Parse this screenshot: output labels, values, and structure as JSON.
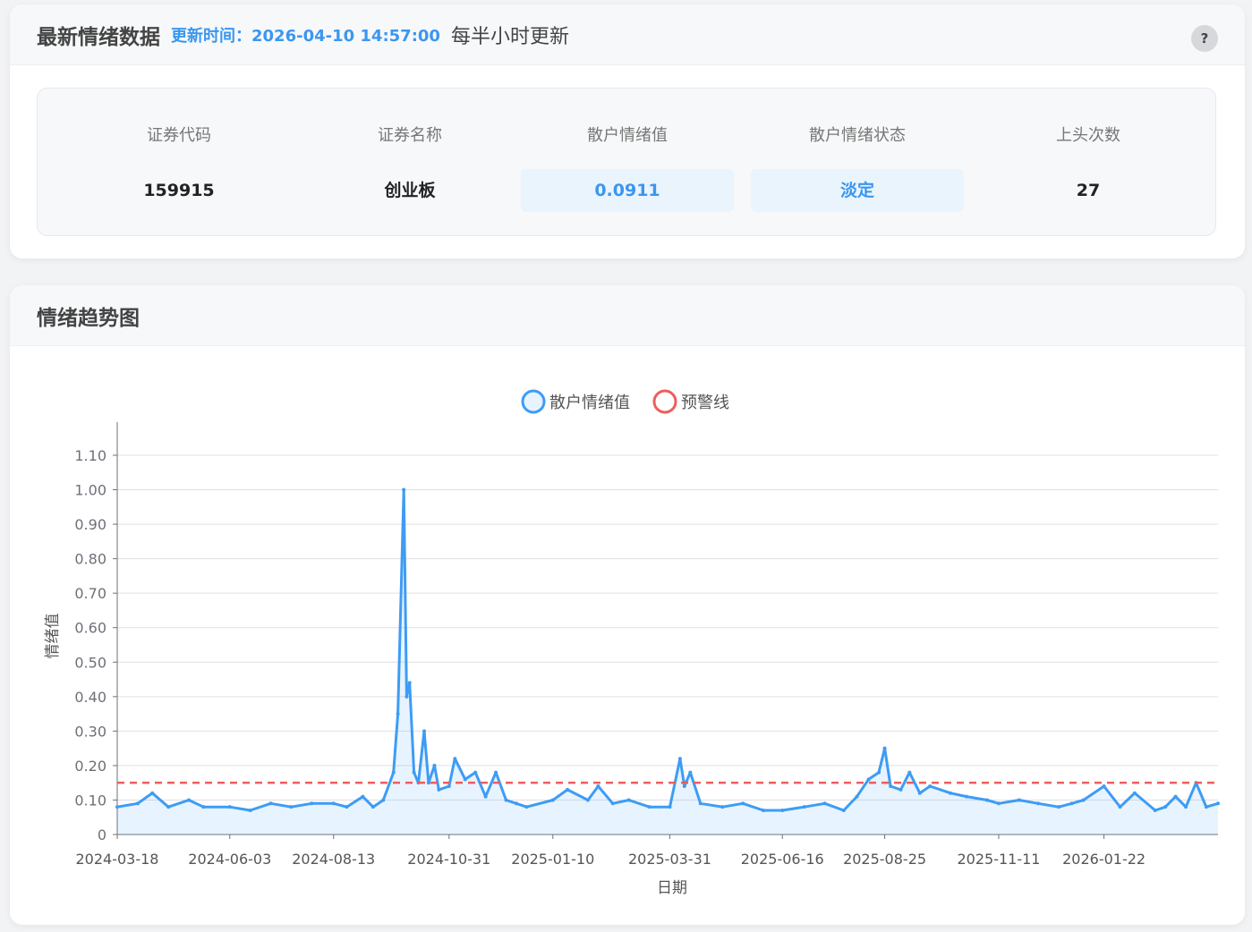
{
  "header": {
    "title": "最新情绪数据",
    "update_time": "更新时间：2026-04-10 14:57:00",
    "frequency": "每半小时更新",
    "help_label": "?"
  },
  "stats": [
    {
      "label": "证券代码",
      "value": "159915",
      "highlight": false
    },
    {
      "label": "证券名称",
      "value": "创业板",
      "highlight": false
    },
    {
      "label": "散户情绪值",
      "value": "0.0911",
      "highlight": true
    },
    {
      "label": "散户情绪状态",
      "value": "淡定",
      "highlight": true
    },
    {
      "label": "上头次数",
      "value": "27",
      "highlight": false
    }
  ],
  "trend": {
    "title": "情绪趋势图"
  },
  "colors": {
    "accent": "#3a97f0",
    "line": "#3d9cf5",
    "warning": "#ee5d5d"
  },
  "chart_data": {
    "type": "line",
    "title": "",
    "xlabel": "日期",
    "ylabel": "情绪值",
    "ylim": [
      0,
      1.1
    ],
    "yticks": [
      "0",
      "0.10",
      "0.20",
      "0.30",
      "0.40",
      "0.50",
      "0.60",
      "0.70",
      "0.80",
      "0.90",
      "1.00",
      "1.10"
    ],
    "xticks": [
      "2024-03-18",
      "2024-06-03",
      "2024-08-13",
      "2024-10-31",
      "2025-01-10",
      "2025-03-31",
      "2025-06-16",
      "2025-08-25",
      "2025-11-11",
      "2026-01-22"
    ],
    "legend": {
      "position": "top",
      "items": [
        "散户情绪值",
        "预警线"
      ]
    },
    "grid": true,
    "warning_line": {
      "name": "预警线",
      "value": 0.15
    },
    "series": [
      {
        "name": "散户情绪值",
        "points": [
          [
            "2024-03-18",
            0.08
          ],
          [
            "2024-04-01",
            0.09
          ],
          [
            "2024-04-11",
            0.12
          ],
          [
            "2024-04-22",
            0.08
          ],
          [
            "2024-05-06",
            0.1
          ],
          [
            "2024-05-16",
            0.08
          ],
          [
            "2024-06-03",
            0.08
          ],
          [
            "2024-06-17",
            0.07
          ],
          [
            "2024-07-01",
            0.09
          ],
          [
            "2024-07-15",
            0.08
          ],
          [
            "2024-07-29",
            0.09
          ],
          [
            "2024-08-13",
            0.09
          ],
          [
            "2024-08-22",
            0.08
          ],
          [
            "2024-09-02",
            0.11
          ],
          [
            "2024-09-09",
            0.08
          ],
          [
            "2024-09-16",
            0.1
          ],
          [
            "2024-09-23",
            0.18
          ],
          [
            "2024-09-26",
            0.35
          ],
          [
            "2024-09-30",
            1.0
          ],
          [
            "2024-10-02",
            0.4
          ],
          [
            "2024-10-04",
            0.44
          ],
          [
            "2024-10-07",
            0.18
          ],
          [
            "2024-10-10",
            0.15
          ],
          [
            "2024-10-14",
            0.3
          ],
          [
            "2024-10-17",
            0.15
          ],
          [
            "2024-10-21",
            0.2
          ],
          [
            "2024-10-24",
            0.13
          ],
          [
            "2024-10-31",
            0.14
          ],
          [
            "2024-11-04",
            0.22
          ],
          [
            "2024-11-11",
            0.16
          ],
          [
            "2024-11-18",
            0.18
          ],
          [
            "2024-11-25",
            0.11
          ],
          [
            "2024-12-02",
            0.18
          ],
          [
            "2024-12-09",
            0.1
          ],
          [
            "2024-12-16",
            0.09
          ],
          [
            "2024-12-23",
            0.08
          ],
          [
            "2025-01-10",
            0.1
          ],
          [
            "2025-01-20",
            0.13
          ],
          [
            "2025-02-03",
            0.1
          ],
          [
            "2025-02-10",
            0.14
          ],
          [
            "2025-02-20",
            0.09
          ],
          [
            "2025-03-03",
            0.1
          ],
          [
            "2025-03-17",
            0.08
          ],
          [
            "2025-03-31",
            0.08
          ],
          [
            "2025-04-07",
            0.22
          ],
          [
            "2025-04-10",
            0.14
          ],
          [
            "2025-04-14",
            0.18
          ],
          [
            "2025-04-21",
            0.09
          ],
          [
            "2025-05-06",
            0.08
          ],
          [
            "2025-05-20",
            0.09
          ],
          [
            "2025-06-03",
            0.07
          ],
          [
            "2025-06-16",
            0.07
          ],
          [
            "2025-07-01",
            0.08
          ],
          [
            "2025-07-15",
            0.09
          ],
          [
            "2025-07-28",
            0.07
          ],
          [
            "2025-08-06",
            0.11
          ],
          [
            "2025-08-14",
            0.16
          ],
          [
            "2025-08-21",
            0.18
          ],
          [
            "2025-08-25",
            0.25
          ],
          [
            "2025-08-29",
            0.14
          ],
          [
            "2025-09-05",
            0.13
          ],
          [
            "2025-09-11",
            0.18
          ],
          [
            "2025-09-18",
            0.12
          ],
          [
            "2025-09-25",
            0.14
          ],
          [
            "2025-10-09",
            0.12
          ],
          [
            "2025-10-20",
            0.11
          ],
          [
            "2025-11-03",
            0.1
          ],
          [
            "2025-11-11",
            0.09
          ],
          [
            "2025-11-25",
            0.1
          ],
          [
            "2025-12-08",
            0.09
          ],
          [
            "2025-12-22",
            0.08
          ],
          [
            "2025-12-31",
            0.09
          ],
          [
            "2026-01-08",
            0.1
          ],
          [
            "2026-01-22",
            0.14
          ],
          [
            "2026-02-02",
            0.08
          ],
          [
            "2026-02-12",
            0.12
          ],
          [
            "2026-02-26",
            0.07
          ],
          [
            "2026-03-05",
            0.08
          ],
          [
            "2026-03-12",
            0.11
          ],
          [
            "2026-03-19",
            0.08
          ],
          [
            "2026-03-26",
            0.15
          ],
          [
            "2026-04-02",
            0.08
          ],
          [
            "2026-04-10",
            0.09
          ]
        ]
      }
    ]
  }
}
